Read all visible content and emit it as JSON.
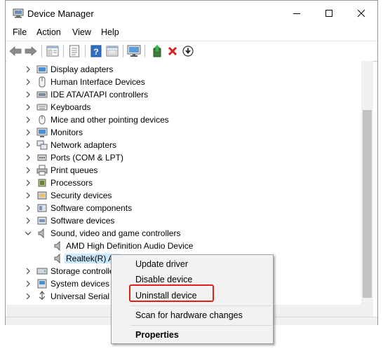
{
  "window": {
    "title": "Device Manager",
    "controls": [
      "minimize",
      "maximize",
      "close"
    ]
  },
  "menu": [
    "File",
    "Action",
    "View",
    "Help"
  ],
  "toolbar": {
    "icons": [
      "back-icon",
      "forward-icon",
      "properties-icon",
      "list-icon",
      "help-icon",
      "view-icon",
      "monitor-icon",
      "update-driver-icon",
      "uninstall-icon",
      "download-icon"
    ]
  },
  "tree": {
    "items": [
      {
        "label": "Display adapters",
        "icon": "display-adapter-icon",
        "expanded": false
      },
      {
        "label": "Human Interface Devices",
        "icon": "hid-icon",
        "expanded": false
      },
      {
        "label": "IDE ATA/ATAPI controllers",
        "icon": "ide-icon",
        "expanded": false
      },
      {
        "label": "Keyboards",
        "icon": "keyboard-icon",
        "expanded": false
      },
      {
        "label": "Mice and other pointing devices",
        "icon": "mouse-icon",
        "expanded": false
      },
      {
        "label": "Monitors",
        "icon": "monitor-icon",
        "expanded": false
      },
      {
        "label": "Network adapters",
        "icon": "network-icon",
        "expanded": false
      },
      {
        "label": "Ports (COM & LPT)",
        "icon": "port-icon",
        "expanded": false
      },
      {
        "label": "Print queues",
        "icon": "printer-icon",
        "expanded": false
      },
      {
        "label": "Processors",
        "icon": "processor-icon",
        "expanded": false
      },
      {
        "label": "Security devices",
        "icon": "security-icon",
        "expanded": false
      },
      {
        "label": "Software components",
        "icon": "software-component-icon",
        "expanded": false
      },
      {
        "label": "Software devices",
        "icon": "software-device-icon",
        "expanded": false
      },
      {
        "label": "Sound, video and game controllers",
        "icon": "speaker-icon",
        "expanded": true
      },
      {
        "label": "AMD High Definition Audio Device",
        "icon": "speaker-icon",
        "child": true
      },
      {
        "label": "Realtek(R) Au",
        "icon": "speaker-icon",
        "child": true,
        "selected": true
      },
      {
        "label": "Storage controlle",
        "icon": "storage-icon",
        "expanded": false
      },
      {
        "label": "System devices",
        "icon": "system-icon",
        "expanded": false
      },
      {
        "label": "Universal Serial B",
        "icon": "usb-icon",
        "expanded": false
      }
    ]
  },
  "context_menu": {
    "update_driver": "Update driver",
    "disable_device": "Disable device",
    "uninstall_device": "Uninstall device",
    "scan": "Scan for hardware changes",
    "properties": "Properties"
  },
  "colors": {
    "highlight": "#e0201a",
    "selection": "#cce8ff"
  }
}
